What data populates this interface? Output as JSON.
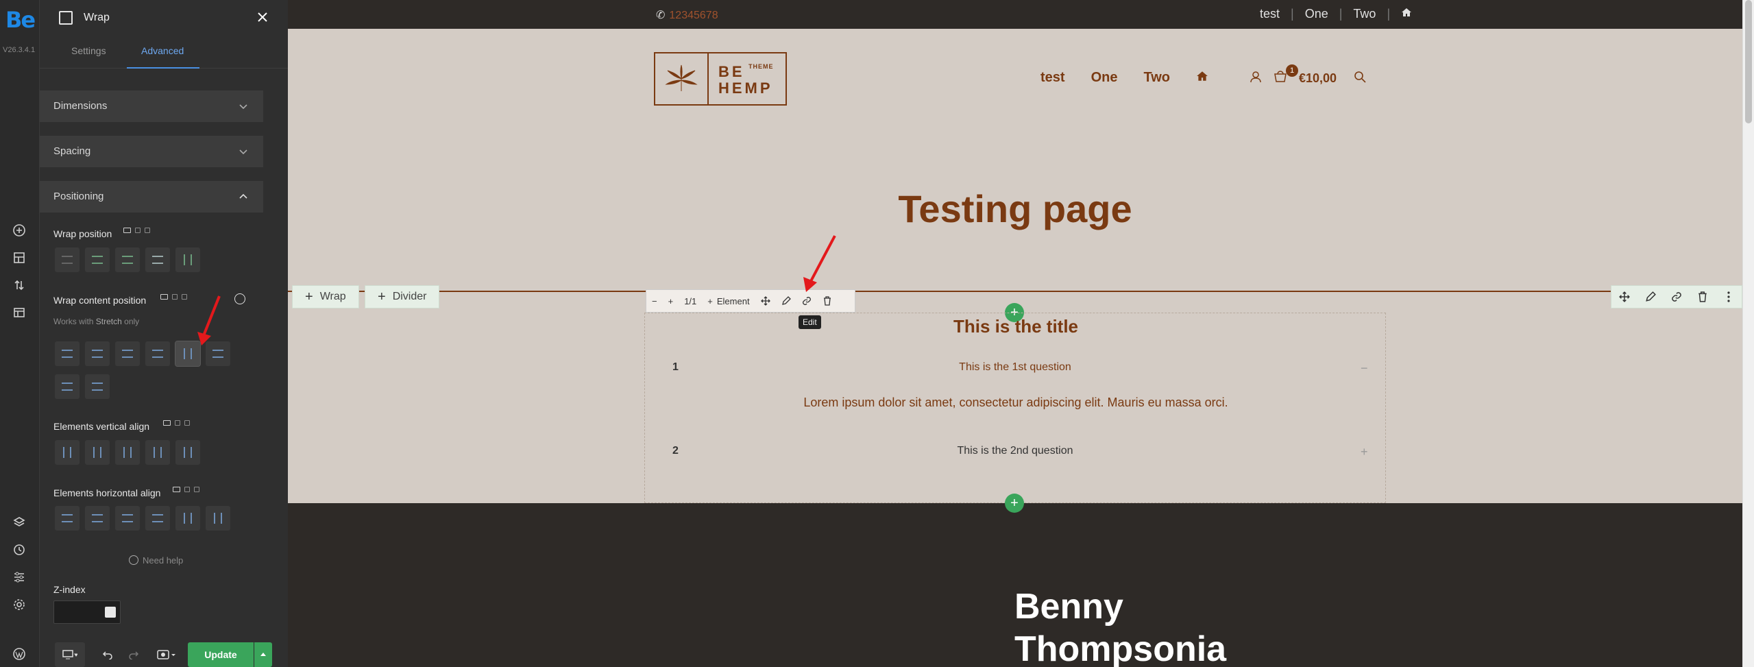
{
  "rail": {
    "logo": "Be",
    "version": "V26.3.4.1",
    "icons": [
      "add-icon",
      "layout-icon",
      "sort-icon",
      "template-icon",
      "layers-icon",
      "history-icon",
      "sliders-icon",
      "gear-icon",
      "wordpress-icon"
    ]
  },
  "panel": {
    "title": "Wrap",
    "tabs": [
      {
        "label": "Settings"
      },
      {
        "label": "Advanced",
        "active": true
      }
    ],
    "sections": {
      "dimensions": "Dimensions",
      "spacing": "Spacing",
      "positioning": "Positioning"
    },
    "wrap_position_label": "Wrap position",
    "wrap_content_position_label": "Wrap content position",
    "hint_prefix": "Works with",
    "hint_bold": "Stretch",
    "hint_suffix": "only",
    "elements_vertical_align_label": "Elements vertical align",
    "elements_horizontal_align_label": "Elements horizontal align",
    "need_help": "Need help",
    "zindex_label": "Z-index",
    "update_label": "Update"
  },
  "site": {
    "phone": "12345678",
    "top_nav": [
      "test",
      "One",
      "Two"
    ],
    "logo": {
      "be": "BE",
      "theme": "THEME",
      "hemp": "HEMP"
    },
    "main_nav": [
      "test",
      "One",
      "Two"
    ],
    "cart_count": "1",
    "cart_total": "€10,00",
    "hero_title": "Testing page",
    "chips": {
      "wrap": "Wrap",
      "divider": "Divider"
    },
    "element_bar": {
      "ratio": "1/1",
      "element": "Element"
    },
    "tooltip": "Edit",
    "accordion": {
      "title": "This is the title",
      "items": [
        {
          "num": "1",
          "question": "This is the 1st question",
          "toggle": "−"
        },
        {
          "num": "2",
          "question": "This is the 2nd question",
          "toggle": "+"
        }
      ],
      "answer": "Lorem ipsum dolor sit amet, consectetur adipiscing elit. Mauris eu massa orci."
    },
    "footer_heading_line1": "Benny",
    "footer_heading_line2": "Thompsonia"
  },
  "colors": {
    "brand": "#7a3a12",
    "accent_blue": "#4a90e2",
    "green": "#3aa55b",
    "page_bg": "#d4ccc5",
    "dark": "#2e2a27"
  }
}
